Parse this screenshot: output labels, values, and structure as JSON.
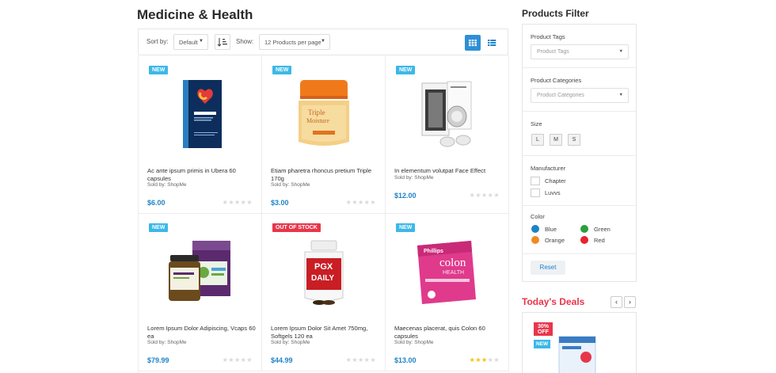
{
  "page": {
    "title": "Medicine & Health"
  },
  "toolbar": {
    "sort_label": "Sort by:",
    "sort_value": "Default",
    "show_label": "Show:",
    "show_value": "12 Products per page",
    "sort_direction_icon": "sort-ascending-icon",
    "grid_view_icon": "grid-view-icon",
    "list_view_icon": "list-view-icon",
    "active_view": "grid"
  },
  "products": [
    {
      "badge": "NEW",
      "badge_type": "new",
      "name": "Ac ante ipsum primis in Ubera 60 capsules",
      "sold_by": "Sold by: ShopMe",
      "price": "$6.00",
      "rating": 0
    },
    {
      "badge": "NEW",
      "badge_type": "new",
      "name": "Etiam pharetra rhoncus pretium Triple 170g",
      "sold_by": "Sold by: ShopMe",
      "price": "$3.00",
      "rating": 0
    },
    {
      "badge": "NEW",
      "badge_type": "new",
      "name": "In elementum volutpat Face Effect",
      "sold_by": "Sold by: ShopMe",
      "price": "$12.00",
      "rating": 0
    },
    {
      "badge": "NEW",
      "badge_type": "new",
      "name": "Lorem Ipsum Dolor Adipiscing, Vcaps 60 ea",
      "sold_by": "Sold by: ShopMe",
      "price": "$79.99",
      "rating": 0
    },
    {
      "badge": "OUT OF STOCK",
      "badge_type": "oos",
      "name": "Lorem Ipsum Dolor Sit Amet 750mg, Softgels 120 ea",
      "sold_by": "Sold by: ShopMe",
      "price": "$44.99",
      "rating": 0
    },
    {
      "badge": "NEW",
      "badge_type": "new",
      "name": "Maecenas placerat, quis Colon 60 capsules",
      "sold_by": "Sold by: ShopMe",
      "price": "$13.00",
      "rating": 3
    }
  ],
  "sidebar": {
    "title": "Products Filter",
    "tags": {
      "label": "Product Tags",
      "placeholder": "Product Tags"
    },
    "categories": {
      "label": "Product Categories",
      "placeholder": "Product Categories"
    },
    "size": {
      "label": "Size",
      "options": [
        "L",
        "M",
        "S"
      ]
    },
    "manufacturer": {
      "label": "Manufacturer",
      "options": [
        "Chapter",
        "Luvvs"
      ]
    },
    "color": {
      "label": "Color",
      "options": [
        {
          "name": "Blue",
          "hex": "#1e82c8"
        },
        {
          "name": "Green",
          "hex": "#2e9e3e"
        },
        {
          "name": "Orange",
          "hex": "#f08a24"
        },
        {
          "name": "Red",
          "hex": "#e8232d"
        }
      ]
    },
    "reset_label": "Reset"
  },
  "deals": {
    "title": "Today's Deals",
    "prev_icon": "chevron-left-icon",
    "next_icon": "chevron-right-icon",
    "discount_line1": "30%",
    "discount_line2": "OFF",
    "badge": "NEW"
  },
  "colors": {
    "accent": "#1e82c8",
    "new_badge": "#3cb8e8",
    "sale_badge": "#e8364b"
  }
}
